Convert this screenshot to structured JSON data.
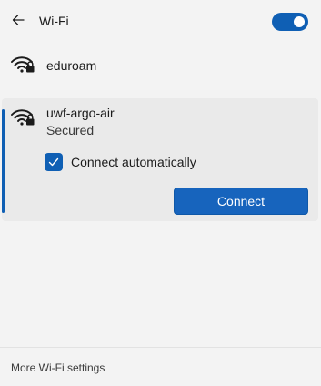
{
  "header": {
    "title": "Wi-Fi",
    "back_icon": "arrow-left-icon",
    "wifi_enabled": true
  },
  "networks": [
    {
      "ssid": "eduroam",
      "icon": "wifi-secured-icon"
    },
    {
      "ssid": "uwf-argo-air",
      "icon": "wifi-secured-icon",
      "status": "Secured",
      "connect_automatically_label": "Connect automatically",
      "connect_automatically_checked": true,
      "connect_label": "Connect"
    }
  ],
  "footer": {
    "more_settings_label": "More Wi-Fi settings"
  },
  "colors": {
    "accent": "#0f5fb4",
    "background": "#f3f3f3",
    "selected_background": "#eaeaea"
  }
}
